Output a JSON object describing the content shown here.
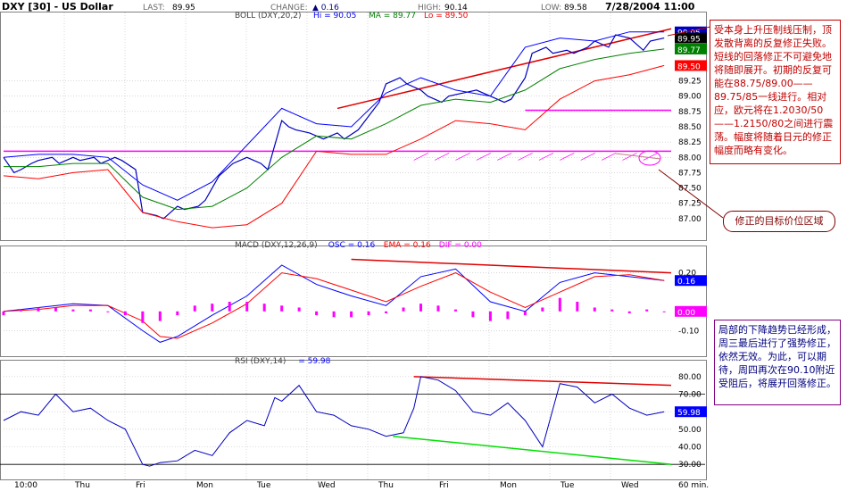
{
  "header": {
    "symbol": "DXY [30] - US Dollar",
    "last_label": "LAST:",
    "last": "89.95",
    "change_label": "CHANGE:",
    "change": "▲ 0.16",
    "high_label": "HIGH:",
    "high": "90.14",
    "low_label": "LOW:",
    "low": "89.58",
    "datetime": "7/28/2004 11:00"
  },
  "colors": {
    "price": "#0000c0",
    "boll": "#0000ff",
    "ma": "#008000",
    "lo": "#ff0000",
    "trend": "#e00000",
    "support": "#ff00ff",
    "green": "#00e000",
    "grid": "#c0c0c0"
  },
  "chart_data": [
    {
      "type": "line",
      "title": "BOLL (DXY,20,2)",
      "legend": [
        {
          "label": "Hi = 90.05",
          "color": "#0000ff"
        },
        {
          "label": "MA = 89.77",
          "color": "#008000"
        },
        {
          "label": "Lo = 89.50",
          "color": "#ff0000"
        }
      ],
      "x_ticks": [
        "10:00",
        "Thu",
        "Fri",
        "Mon",
        "Tue",
        "Wed",
        "Thu",
        "Fri",
        "Mon",
        "Tue",
        "Wed"
      ],
      "x_unit": "60 min.",
      "y_ticks": [
        "87.00",
        "87.25",
        "87.50",
        "87.75",
        "88.00",
        "88.25",
        "88.50",
        "88.75",
        "89.00",
        "89.25"
      ],
      "ylim": [
        86.75,
        90.25
      ],
      "value_tags": [
        {
          "value": 90.05,
          "text": "90.05",
          "bg": "#0000c0",
          "fg": "#ffffff"
        },
        {
          "value": 89.95,
          "text": "89.95",
          "bg": "#000000",
          "fg": "#ffffff"
        },
        {
          "value": 89.77,
          "text": "89.77",
          "bg": "#008000",
          "fg": "#ffffff"
        },
        {
          "value": 89.5,
          "text": "89.50",
          "bg": "#ff0000",
          "fg": "#ffffff"
        }
      ],
      "series": [
        {
          "name": "Price",
          "x": [
            0,
            3,
            5,
            8,
            10,
            14,
            16,
            20,
            22,
            26,
            28,
            32,
            34,
            38,
            40,
            44,
            46,
            50,
            52,
            56,
            58,
            62,
            66,
            70,
            74,
            76,
            80,
            82,
            84,
            88,
            92,
            96,
            98,
            102,
            104,
            108,
            110,
            114,
            116,
            120,
            122,
            126,
            128,
            132,
            136,
            140,
            144,
            146,
            150,
            152,
            156,
            158,
            162,
            164,
            168,
            170,
            174,
            176,
            180,
            184,
            186,
            190
          ],
          "y": [
            88.0,
            87.75,
            87.8,
            87.9,
            87.95,
            88.0,
            87.9,
            88.0,
            87.95,
            88.0,
            87.9,
            88.0,
            87.95,
            87.8,
            87.1,
            87.05,
            87.0,
            87.2,
            87.15,
            87.2,
            87.3,
            87.7,
            87.9,
            88.0,
            87.9,
            87.8,
            88.6,
            88.5,
            88.45,
            88.4,
            88.3,
            88.4,
            88.3,
            88.45,
            88.6,
            88.9,
            89.2,
            89.3,
            89.2,
            89.1,
            89.0,
            88.9,
            89.0,
            89.05,
            89.1,
            89.0,
            88.9,
            88.95,
            89.3,
            89.7,
            89.8,
            89.7,
            89.75,
            89.7,
            89.8,
            89.9,
            89.8,
            90.0,
            89.95,
            89.75,
            89.9,
            89.95
          ]
        },
        {
          "name": "Hi",
          "x": [
            0,
            10,
            20,
            30,
            40,
            50,
            60,
            70,
            80,
            90,
            100,
            110,
            120,
            130,
            140,
            150,
            160,
            170,
            180,
            190
          ],
          "y": [
            88.0,
            88.05,
            88.05,
            88.0,
            87.55,
            87.3,
            87.6,
            88.2,
            88.8,
            88.55,
            88.5,
            89.05,
            89.3,
            89.1,
            89.0,
            89.8,
            89.95,
            89.9,
            90.05,
            90.05
          ]
        },
        {
          "name": "MA",
          "x": [
            0,
            10,
            20,
            30,
            40,
            50,
            60,
            70,
            80,
            90,
            100,
            110,
            120,
            130,
            140,
            150,
            160,
            170,
            180,
            190
          ],
          "y": [
            87.85,
            87.85,
            87.9,
            87.9,
            87.35,
            87.15,
            87.2,
            87.5,
            88.0,
            88.35,
            88.3,
            88.55,
            88.85,
            88.95,
            88.9,
            89.1,
            89.45,
            89.6,
            89.7,
            89.77
          ]
        },
        {
          "name": "Lo",
          "x": [
            0,
            10,
            20,
            30,
            40,
            50,
            60,
            70,
            80,
            90,
            100,
            110,
            120,
            130,
            140,
            150,
            160,
            170,
            180,
            190
          ],
          "y": [
            87.7,
            87.65,
            87.75,
            87.8,
            87.1,
            86.95,
            86.85,
            86.9,
            87.25,
            88.1,
            88.05,
            88.05,
            88.3,
            88.6,
            88.55,
            88.45,
            88.95,
            89.25,
            89.35,
            89.5
          ]
        }
      ],
      "annotations": {
        "trendline": {
          "from": [
            96,
            88.8
          ],
          "to": [
            192,
            90.1
          ]
        },
        "support_line": {
          "from": [
            150,
            88.77
          ],
          "to": [
            192,
            88.77
          ]
        },
        "target_line": {
          "from": [
            0,
            88.1
          ],
          "to": [
            192,
            88.1
          ]
        }
      }
    },
    {
      "type": "line",
      "title": "MACD (DXY,12,26,9)",
      "legend": [
        {
          "label": "OSC = 0.16",
          "color": "#0000ff"
        },
        {
          "label": "EMA = 0.16",
          "color": "#ff0000"
        },
        {
          "label": "DIF = 0.00",
          "color": "#ff00ff"
        }
      ],
      "y_ticks": [
        "0.20",
        "-0.10"
      ],
      "ylim": [
        -0.2,
        0.3
      ],
      "value_tags": [
        {
          "value": 0.16,
          "text": "0.16",
          "bg": "#0000ff",
          "fg": "#ffffff"
        },
        {
          "value": 0.0,
          "text": "0.00",
          "bg": "#ff00ff",
          "fg": "#ffffff"
        }
      ],
      "series": [
        {
          "name": "OSC",
          "x": [
            0,
            10,
            20,
            30,
            40,
            45,
            50,
            60,
            70,
            80,
            90,
            100,
            110,
            120,
            130,
            140,
            150,
            160,
            170,
            180,
            190
          ],
          "y": [
            0.0,
            0.02,
            0.04,
            0.03,
            -0.1,
            -0.16,
            -0.13,
            -0.02,
            0.08,
            0.24,
            0.14,
            0.08,
            0.03,
            0.18,
            0.22,
            0.05,
            0.0,
            0.15,
            0.2,
            0.18,
            0.16
          ]
        },
        {
          "name": "EMA",
          "x": [
            0,
            10,
            20,
            30,
            40,
            45,
            50,
            60,
            70,
            80,
            90,
            100,
            110,
            120,
            130,
            140,
            150,
            160,
            170,
            180,
            190
          ],
          "y": [
            0.0,
            0.01,
            0.03,
            0.03,
            -0.05,
            -0.13,
            -0.14,
            -0.06,
            0.04,
            0.2,
            0.17,
            0.11,
            0.05,
            0.13,
            0.2,
            0.1,
            0.02,
            0.1,
            0.18,
            0.19,
            0.16
          ]
        },
        {
          "name": "DIF",
          "type": "bar",
          "x": [
            0,
            5,
            10,
            15,
            20,
            25,
            30,
            35,
            40,
            45,
            50,
            55,
            60,
            65,
            70,
            75,
            80,
            85,
            90,
            95,
            100,
            105,
            110,
            115,
            120,
            125,
            130,
            135,
            140,
            145,
            150,
            155,
            160,
            165,
            170,
            175,
            180,
            185,
            190
          ],
          "y": [
            -0.02,
            0.01,
            0.02,
            0.02,
            0.01,
            0.01,
            0.0,
            -0.02,
            -0.06,
            -0.05,
            -0.02,
            0.03,
            0.04,
            0.05,
            0.05,
            0.04,
            0.03,
            0.02,
            -0.02,
            -0.03,
            -0.03,
            -0.02,
            -0.01,
            0.02,
            0.04,
            0.03,
            0.01,
            -0.03,
            -0.05,
            -0.04,
            -0.02,
            0.02,
            0.07,
            0.05,
            0.02,
            0.01,
            -0.01,
            0.01,
            0.0
          ]
        }
      ],
      "annotations": {
        "trendline": {
          "from": [
            100,
            0.27
          ],
          "to": [
            192,
            0.2
          ]
        }
      }
    },
    {
      "type": "line",
      "title": "RSI (DXY,14)",
      "legend": [
        {
          "label": "= 59.98",
          "color": "#0000ff"
        }
      ],
      "y_ticks": [
        "80.00",
        "70.00",
        "60.00",
        "50.00",
        "40.00",
        "30.00"
      ],
      "ylim": [
        25,
        85
      ],
      "reference_lines": [
        70,
        30
      ],
      "value_tags": [
        {
          "value": 59.98,
          "text": "59.98",
          "bg": "#0000ff",
          "fg": "#ffffff"
        }
      ],
      "series": [
        {
          "name": "RSI",
          "x": [
            0,
            5,
            10,
            15,
            20,
            25,
            30,
            35,
            40,
            42,
            45,
            50,
            55,
            60,
            65,
            70,
            75,
            78,
            80,
            85,
            90,
            95,
            100,
            105,
            110,
            115,
            118,
            120,
            125,
            130,
            135,
            140,
            145,
            150,
            155,
            160,
            165,
            170,
            175,
            180,
            185,
            190
          ],
          "y": [
            55,
            60,
            58,
            70,
            60,
            62,
            55,
            50,
            30,
            29,
            31,
            32,
            38,
            35,
            48,
            55,
            52,
            68,
            66,
            75,
            60,
            58,
            52,
            50,
            46,
            48,
            62,
            80,
            78,
            72,
            60,
            58,
            65,
            55,
            40,
            76,
            74,
            65,
            70,
            62,
            58,
            60
          ]
        }
      ],
      "annotations": {
        "resistance": {
          "from": [
            118,
            80
          ],
          "to": [
            192,
            75
          ]
        },
        "support": {
          "from": [
            112,
            46
          ],
          "to": [
            192,
            30
          ]
        }
      }
    }
  ],
  "notes": {
    "resistance_note": "受本身上升压制线压制，顶发散背离的反复修正失败。短线的回落修正不可避免地将随即展开。初期的反复可能在88.75/89.00——89.75/85一线进行。相对应，欧元将在1.2030/50——1.2150/80之间进行震荡。幅度将随着日元的修正幅度而略有变化。",
    "target_note": "修正的目标价位区域",
    "trend_note": "局部的下降趋势已经形成，周三最后进行了强势修正，依然无效。为此，可以期待，周四再次在90.10附近受阻后，将展开回落修正。"
  }
}
